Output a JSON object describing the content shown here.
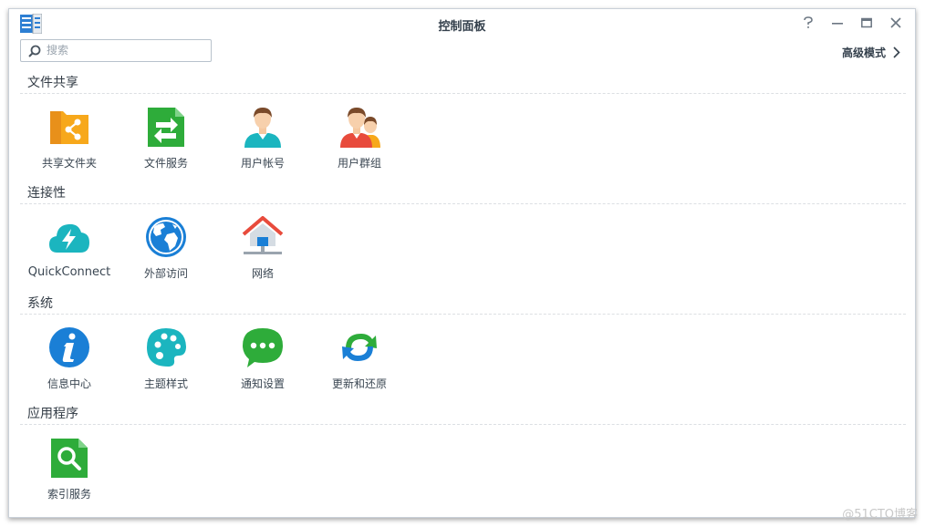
{
  "window": {
    "title": "控制面板"
  },
  "search": {
    "placeholder": "搜索"
  },
  "header": {
    "advanced_mode_label": "高级模式"
  },
  "sections": [
    {
      "title": "文件共享",
      "items": [
        {
          "label": "共享文件夹",
          "icon": "shared-folder-icon"
        },
        {
          "label": "文件服务",
          "icon": "file-services-icon"
        },
        {
          "label": "用户帐号",
          "icon": "user-icon"
        },
        {
          "label": "用户群组",
          "icon": "group-icon"
        }
      ]
    },
    {
      "title": "连接性",
      "items": [
        {
          "label": "QuickConnect",
          "icon": "quickconnect-cloud-icon"
        },
        {
          "label": "外部访问",
          "icon": "globe-icon"
        },
        {
          "label": "网络",
          "icon": "network-home-icon"
        }
      ]
    },
    {
      "title": "系统",
      "items": [
        {
          "label": "信息中心",
          "icon": "info-icon"
        },
        {
          "label": "主题样式",
          "icon": "palette-icon"
        },
        {
          "label": "通知设置",
          "icon": "chat-bubble-icon"
        },
        {
          "label": "更新和还原",
          "icon": "update-restore-icon"
        }
      ]
    },
    {
      "title": "应用程序",
      "items": [
        {
          "label": "索引服务",
          "icon": "indexing-search-icon"
        }
      ]
    }
  ],
  "watermark": "@51CTO博客",
  "colors": {
    "folder_orange": "#f7a81b",
    "green": "#2eac3a",
    "teal": "#1bb5bf",
    "blue": "#1a7fd6",
    "red": "#e84b3c"
  }
}
